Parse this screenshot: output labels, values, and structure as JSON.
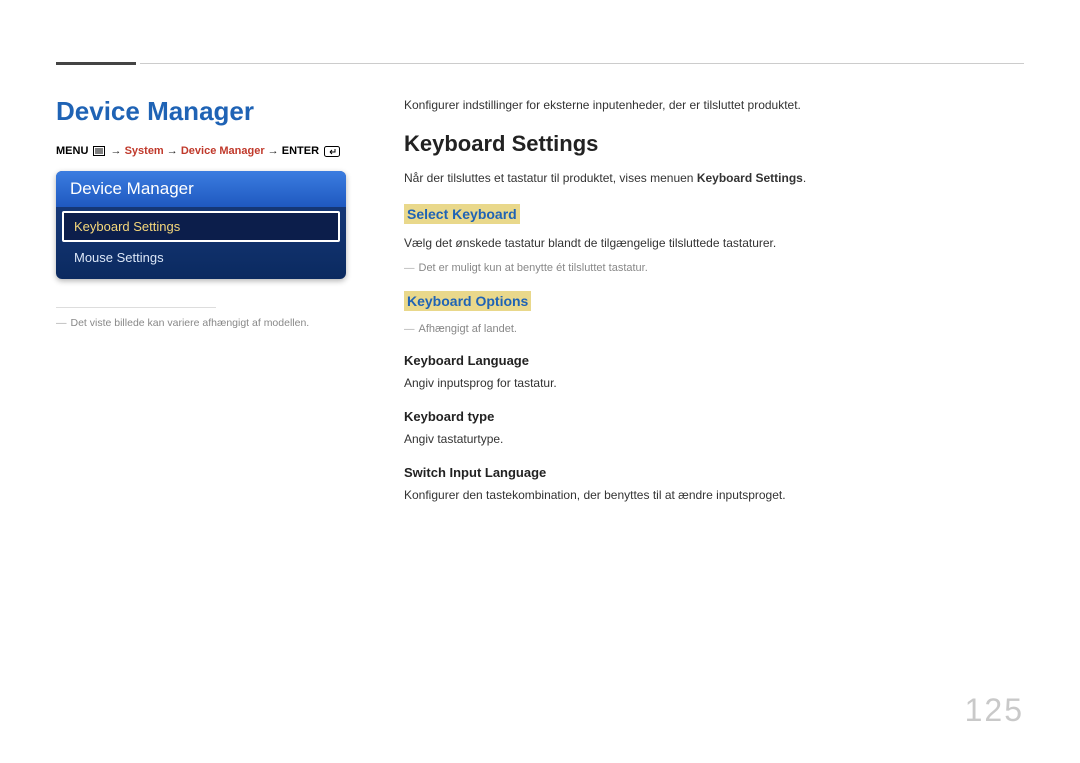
{
  "page": {
    "section_title": "Device Manager",
    "page_number": "125"
  },
  "breadcrumb": {
    "menu_label": "MENU",
    "arrow": "→",
    "path1": "System",
    "path2": "Device Manager",
    "enter_label": "ENTER"
  },
  "osd": {
    "header": "Device Manager",
    "item_selected": "Keyboard Settings",
    "item_2": "Mouse Settings"
  },
  "left_note": "Det viste billede kan variere afhængigt af modellen.",
  "intro_text": "Konfigurer indstillinger for eksterne inputenheder, der er tilsluttet produktet.",
  "keyboard_settings": {
    "heading": "Keyboard Settings",
    "line_prefix": "Når der tilsluttes et tastatur til produktet, vises menuen ",
    "line_bold": "Keyboard Settings",
    "line_suffix": "."
  },
  "select_keyboard": {
    "heading": "Select Keyboard",
    "body": "Vælg det ønskede tastatur blandt de tilgængelige tilsluttede tastaturer.",
    "note": "Det er muligt kun at benytte ét tilsluttet tastatur."
  },
  "keyboard_options": {
    "heading": "Keyboard Options",
    "note": "Afhængigt af landet.",
    "lang_h": "Keyboard Language",
    "lang_b": "Angiv inputsprog for tastatur.",
    "type_h": "Keyboard type",
    "type_b": "Angiv tastaturtype.",
    "switch_h": "Switch Input Language",
    "switch_b": "Konfigurer den tastekombination, der benyttes til at ændre inputsproget."
  }
}
